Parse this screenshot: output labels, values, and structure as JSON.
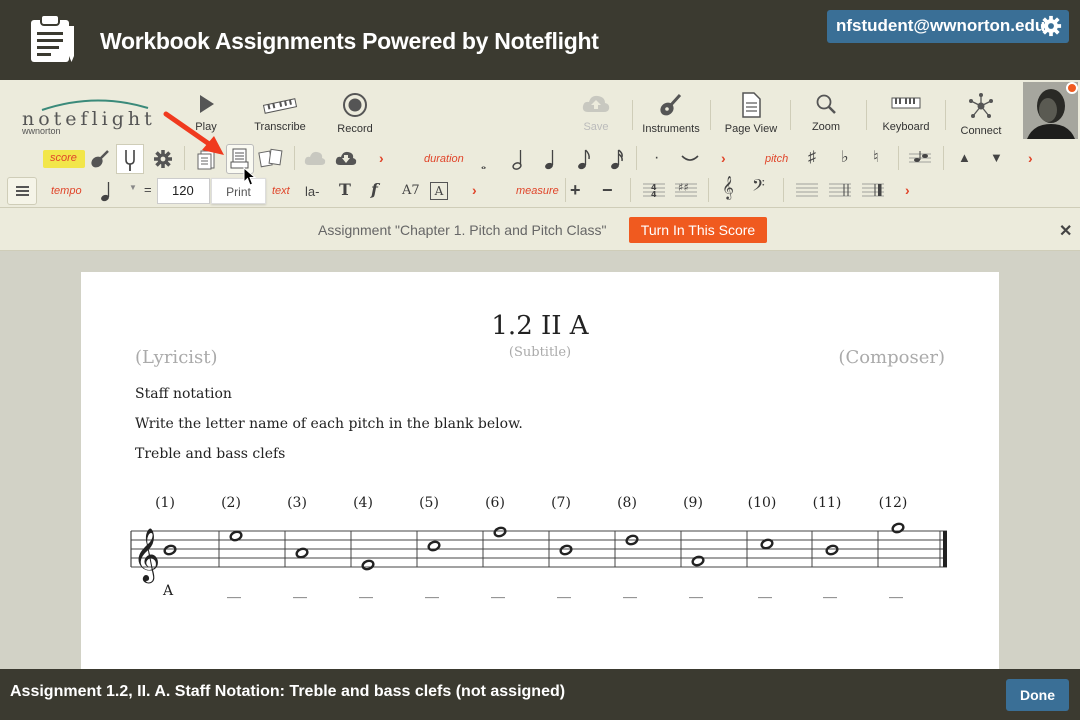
{
  "header": {
    "title": "Workbook Assignments Powered by Noteflight",
    "user_email": "nfstudent@wwnorton.edu"
  },
  "logo": {
    "word": "noteflight",
    "sub": "wwnorton"
  },
  "toolbar": {
    "play": "Play",
    "transcribe": "Transcribe",
    "record": "Record",
    "save": "Save",
    "instruments": "Instruments",
    "page_view": "Page View",
    "zoom": "Zoom",
    "keyboard": "Keyboard",
    "connect": "Connect"
  },
  "palette": {
    "score": "score",
    "duration": "duration",
    "pitch": "pitch",
    "tempo": "tempo",
    "tempo_value": "120",
    "equals": "=",
    "text": "text",
    "lyric": "la-",
    "text_bold": "T",
    "dynamic": "f",
    "chord": "A7",
    "rehearsal": "A",
    "measure": "measure",
    "print_tooltip": "Print"
  },
  "assignment_bar": {
    "text": "Assignment \"Chapter 1. Pitch and Pitch Class\"",
    "turn_in": "Turn In This Score"
  },
  "score": {
    "title": "1.2 II A",
    "subtitle": "(Subtitle)",
    "lyricist": "(Lyricist)",
    "composer": "(Composer)",
    "lines": [
      "Staff notation",
      "Write the letter name of each pitch in the blank below.",
      "Treble and bass clefs"
    ],
    "measure_numbers": [
      "(1)",
      "(2)",
      "(3)",
      "(4)",
      "(5)",
      "(6)",
      "(7)",
      "(8)",
      "(9)",
      "(10)",
      "(11)",
      "(12)"
    ],
    "answers": [
      "A",
      "__",
      "__",
      "__",
      "__",
      "__",
      "__",
      "__",
      "__",
      "__",
      "__",
      "__"
    ]
  },
  "footer": {
    "text": "Assignment 1.2, II. A. Staff Notation: Treble and bass clefs (not assigned)",
    "done": "Done"
  },
  "colors": {
    "header_bg": "#3b3a30",
    "toolbar_bg": "#ecebdc",
    "accent_orange": "#f05a1f",
    "button_blue": "#3a6f96",
    "palette_red": "#e0452a"
  }
}
